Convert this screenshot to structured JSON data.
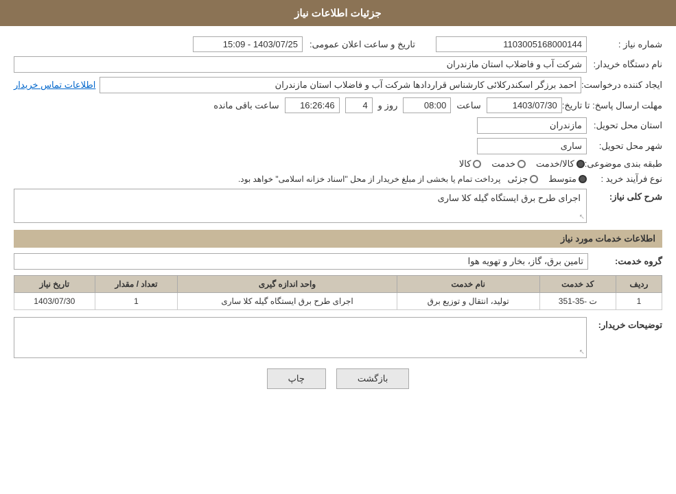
{
  "header": {
    "title": "جزئیات اطلاعات نیاز"
  },
  "fields": {
    "shomara_niaz_label": "شماره نیاز :",
    "shomara_niaz_value": "1103005168000144",
    "nam_dastgah_label": "نام دستگاه خریدار:",
    "nam_dastgah_value": "شرکت آب و فاضلاب استان مازندران",
    "ijad_konande_label": "ایجاد کننده درخواست:",
    "ijad_konande_value": "احمد برزگر اسکندرکلائی کارشناس قراردادها شرکت آب و فاضلاب استان مازندران",
    "ettelaat_tamas_label": "اطلاعات تماس خریدار",
    "tarikh_label": "تاریخ و ساعت اعلان عمومی:",
    "tarikh_value": "1403/07/25 - 15:09",
    "mohlet_label": "مهلت ارسال پاسخ: تا تاریخ:",
    "date_val": "1403/07/30",
    "saat_label": "ساعت",
    "saat_val": "08:00",
    "roz_label": "روز و",
    "roz_val": "4",
    "baqi_saat_val": "16:26:46",
    "baqi_label": "ساعت باقی مانده",
    "ostan_label": "استان محل تحویل:",
    "ostan_value": "مازندران",
    "shahr_label": "شهر محل تحویل:",
    "shahr_value": "ساری",
    "tabaqe_label": "طبقه بندی موضوعی:",
    "kala_label": "کالا",
    "khedmat_label": "خدمت",
    "kala_khedmat_label": "کالا/خدمت",
    "kala_khedmat_selected": "khedmat",
    "noe_farayand_label": "نوع فرآیند خرید :",
    "jozee_label": "جزئی",
    "motovaset_label": "متوسط",
    "noe_selected": "motovaset",
    "purchase_note": "پرداخت تمام یا بخشی از مبلغ خریدار از محل \"اسناد خزانه اسلامی\" خواهد بود.",
    "sharh_label": "شرح کلی نیاز:",
    "sharh_value": "اجرای طرح برق ایستگاه گیله کلا ساری",
    "services_section_title": "اطلاعات خدمات مورد نیاز",
    "grohe_khedmat_label": "گروه خدمت:",
    "grohe_khedmat_value": "تامین برق، گاز، بخار و تهویه هوا",
    "table": {
      "headers": [
        "ردیف",
        "کد خدمت",
        "نام خدمت",
        "واحد اندازه گیری",
        "تعداد / مقدار",
        "تاریخ نیاز"
      ],
      "rows": [
        {
          "radif": "1",
          "kod_khedmat": "ت -35-351",
          "nam_khedmat": "تولید، انتقال و توزیع برق",
          "vahed": "اجرای طرح برق ایستگاه گیله کلا ساری",
          "tedad": "1",
          "tarikh_niaz": "1403/07/30"
        }
      ]
    },
    "tozihat_label": "توضیحات خریدار:",
    "tozihat_value": "",
    "btn_print": "چاپ",
    "btn_back": "بازگشت"
  }
}
